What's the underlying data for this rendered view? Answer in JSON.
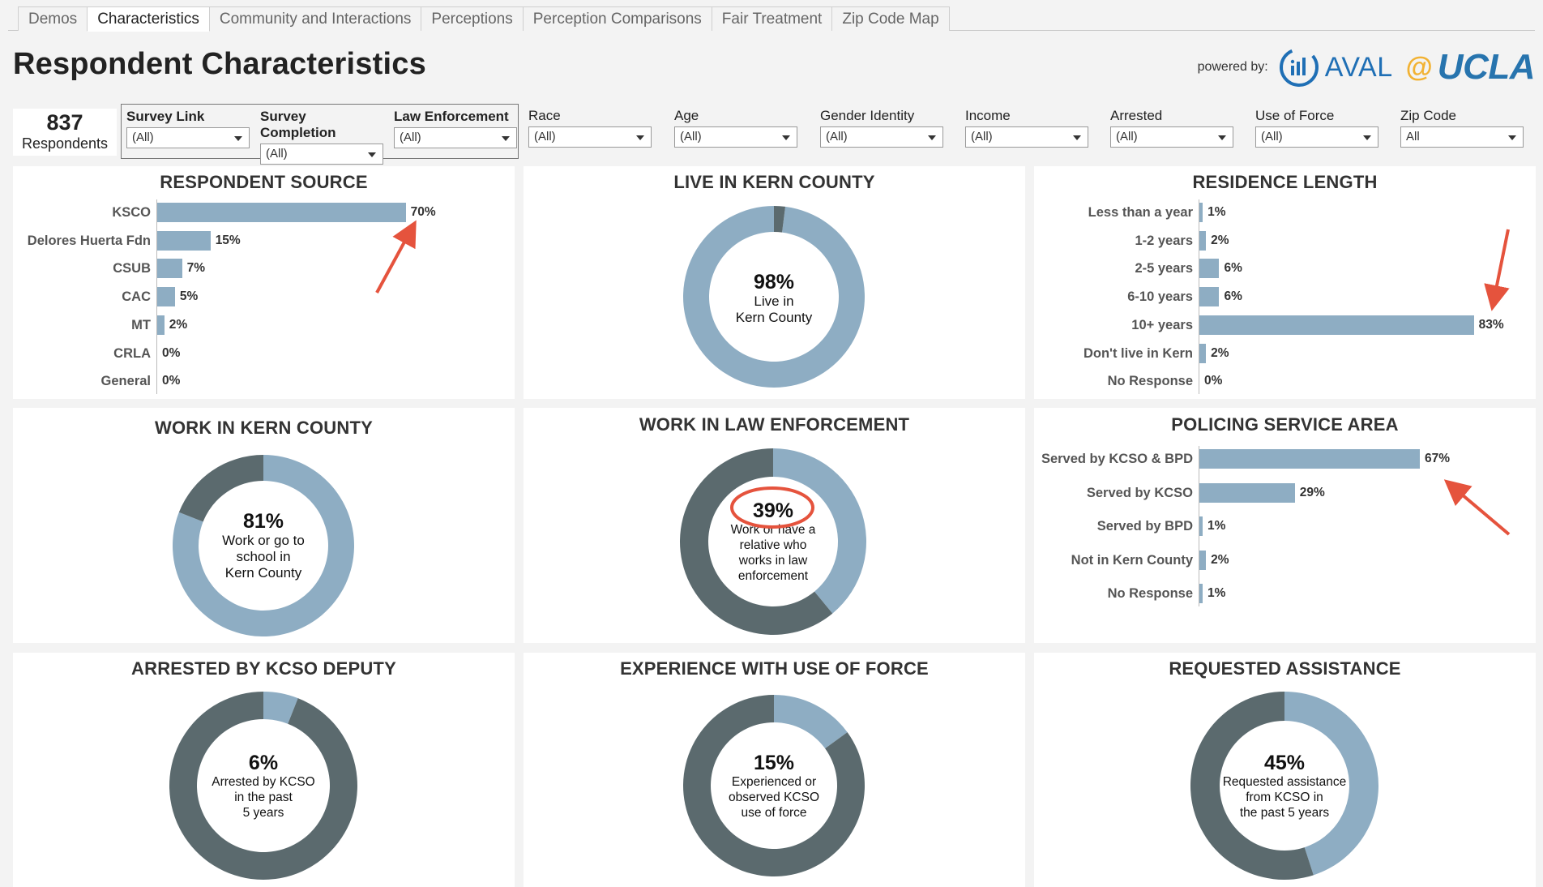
{
  "tabs": [
    "Demos",
    "Characteristics",
    "Community and Interactions",
    "Perceptions",
    "Perception Comparisons",
    "Fair Treatment",
    "Zip Code Map"
  ],
  "active_tab": "Characteristics",
  "header": {
    "title": "Respondent Characteristics",
    "powered_by": "powered by:",
    "aval_text": "AVAL",
    "at_sign": "@",
    "ucla_text": "UCLA"
  },
  "summary": {
    "count": "837",
    "label": "Respondents"
  },
  "filters": [
    {
      "label": "Survey Link",
      "value": "(All)",
      "bold": true
    },
    {
      "label": "Survey Completion",
      "value": "(All)",
      "bold": true
    },
    {
      "label": "Law Enforcement",
      "value": "(All)",
      "bold": true
    },
    {
      "label": "Race",
      "value": "(All)",
      "bold": false
    },
    {
      "label": "Age",
      "value": "(All)",
      "bold": false
    },
    {
      "label": "Gender Identity",
      "value": "(All)",
      "bold": false
    },
    {
      "label": "Income",
      "value": "(All)",
      "bold": false
    },
    {
      "label": "Arrested",
      "value": "(All)",
      "bold": false
    },
    {
      "label": "Use of Force",
      "value": "(All)",
      "bold": false
    },
    {
      "label": "Zip Code",
      "value": "All",
      "bold": false
    }
  ],
  "colors": {
    "light": "#8eadc3",
    "dark": "#5b6a6e",
    "accent_red": "#e5533d",
    "aval_blue": "#1f6fb5",
    "ucla_blue": "#2774ae",
    "ucla_gold": "#f2b233"
  },
  "panels": {
    "respondent_source": {
      "title": "RESPONDENT SOURCE"
    },
    "live_in_kern": {
      "title": "LIVE IN KERN COUNTY",
      "pct": "98%",
      "lines": [
        "Live in",
        "Kern County"
      ]
    },
    "residence_length": {
      "title": "RESIDENCE LENGTH"
    },
    "work_in_kern": {
      "title": "WORK IN KERN COUNTY",
      "pct": "81%",
      "lines": [
        "Work or go to",
        "school in",
        "Kern County"
      ]
    },
    "work_law": {
      "title": "WORK IN LAW ENFORCEMENT",
      "pct": "39%",
      "lines": [
        "Work or have a",
        "relative who",
        "works in law",
        "enforcement"
      ]
    },
    "policing_area": {
      "title": "POLICING SERVICE AREA"
    },
    "arrested": {
      "title": "ARRESTED BY KCSO DEPUTY",
      "pct": "6%",
      "lines": [
        "Arrested by KCSO",
        "in the past",
        "5 years"
      ]
    },
    "use_of_force": {
      "title": "EXPERIENCE WITH USE OF FORCE",
      "pct": "15%",
      "lines": [
        "Experienced or",
        "observed KCSO",
        "use of force"
      ]
    },
    "requested": {
      "title": "REQUESTED ASSISTANCE",
      "pct": "45%",
      "lines": [
        "Requested assistance",
        "from KCSO in",
        "the past 5 years"
      ]
    }
  },
  "chart_data": [
    {
      "type": "bar",
      "orientation": "horizontal",
      "title": "RESPONDENT SOURCE",
      "categories": [
        "KSCO",
        "Delores Huerta Fdn",
        "CSUB",
        "CAC",
        "MT",
        "CRLA",
        "General"
      ],
      "values": [
        70,
        15,
        7,
        5,
        2,
        0,
        0
      ],
      "labels": [
        "70%",
        "15%",
        "7%",
        "5%",
        "2%",
        "0%",
        "0%"
      ]
    },
    {
      "type": "pie",
      "donut": true,
      "title": "LIVE IN KERN COUNTY",
      "categories": [
        "Live in Kern County",
        "Other"
      ],
      "values": [
        98,
        2
      ]
    },
    {
      "type": "bar",
      "orientation": "horizontal",
      "title": "RESIDENCE LENGTH",
      "categories": [
        "Less than a year",
        "1-2 years",
        "2-5 years",
        "6-10 years",
        "10+ years",
        "Don't live in Kern",
        "No Response"
      ],
      "values": [
        1,
        2,
        6,
        6,
        83,
        2,
        0
      ],
      "labels": [
        "1%",
        "2%",
        "6%",
        "6%",
        "83%",
        "2%",
        "0%"
      ]
    },
    {
      "type": "pie",
      "donut": true,
      "title": "WORK IN KERN COUNTY",
      "categories": [
        "Work or go to school in Kern County",
        "Other"
      ],
      "values": [
        81,
        19
      ]
    },
    {
      "type": "pie",
      "donut": true,
      "title": "WORK IN LAW ENFORCEMENT",
      "categories": [
        "Work or have a relative who works in law enforcement",
        "Other"
      ],
      "values": [
        39,
        61
      ]
    },
    {
      "type": "bar",
      "orientation": "horizontal",
      "title": "POLICING SERVICE AREA",
      "categories": [
        "Served by KCSO & BPD",
        "Served by KCSO",
        "Served by BPD",
        "Not in Kern County",
        "No Response"
      ],
      "values": [
        67,
        29,
        1,
        2,
        1
      ],
      "labels": [
        "67%",
        "29%",
        "1%",
        "2%",
        "1%"
      ]
    },
    {
      "type": "pie",
      "donut": true,
      "title": "ARRESTED BY KCSO DEPUTY",
      "categories": [
        "Arrested by KCSO in the past 5 years",
        "Other"
      ],
      "values": [
        6,
        94
      ]
    },
    {
      "type": "pie",
      "donut": true,
      "title": "EXPERIENCE WITH USE OF FORCE",
      "categories": [
        "Experienced or observed KCSO use of force",
        "Other"
      ],
      "values": [
        15,
        85
      ]
    },
    {
      "type": "pie",
      "donut": true,
      "title": "REQUESTED ASSISTANCE",
      "categories": [
        "Requested assistance from KCSO in the past 5 years",
        "Other"
      ],
      "values": [
        45,
        55
      ]
    }
  ]
}
